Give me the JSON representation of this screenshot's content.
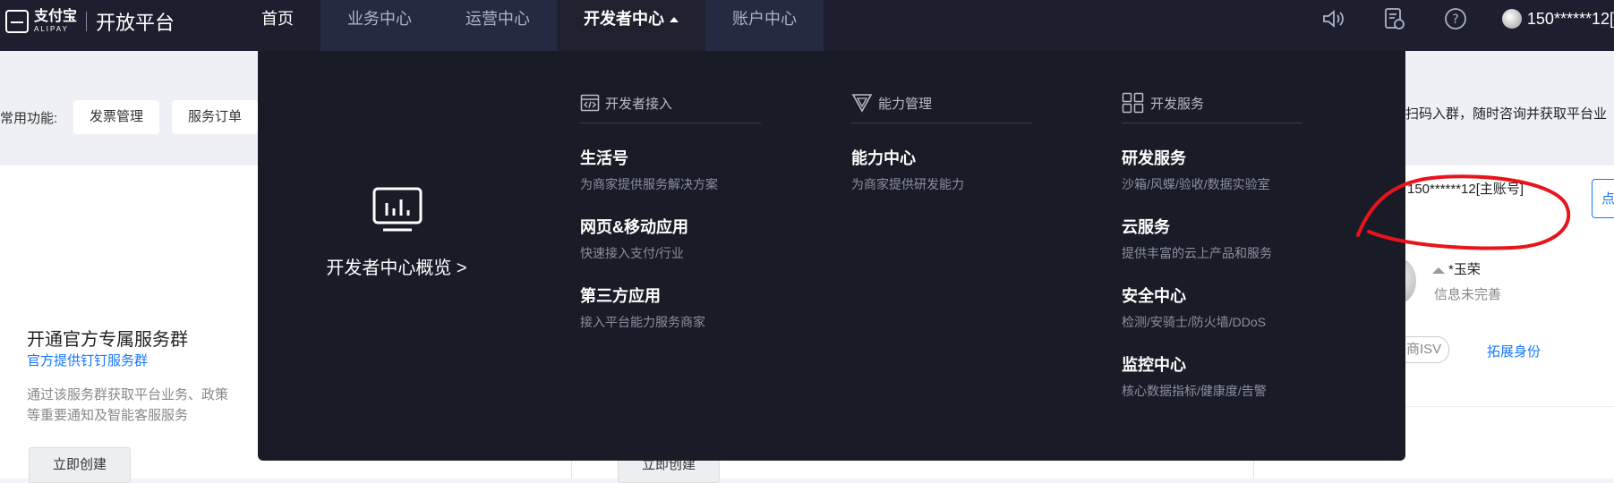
{
  "header": {
    "logo_cn": "支付宝",
    "logo_en": "ALIPAY",
    "platform": "开放平台",
    "nav": [
      {
        "label": "首页"
      },
      {
        "label": "业务中心"
      },
      {
        "label": "运营中心"
      },
      {
        "label": "开发者中心"
      },
      {
        "label": "账户中心"
      }
    ],
    "user": "150******12["
  },
  "quick": {
    "label": "常用功能:",
    "buttons": [
      "发票管理",
      "服务订单"
    ]
  },
  "service_group": {
    "title": "开通官方专属服务群",
    "subtitle": "官方提供钉钉服务群",
    "desc": "通过该服务群获取平台业务、政策等重要通知及智能客服服务",
    "create_left": "立即创建",
    "create_mid": "立即创建"
  },
  "right_panel": {
    "scan_note": "扫码入群，随时咨询并获取平台业",
    "account": "150******12[主账号]",
    "tab": "点",
    "name": "*玉荣",
    "info": "信息未完善",
    "isv": "商ISV",
    "expand": "拓展身份"
  },
  "dropdown": {
    "overview": "开发者中心概览 >",
    "columns": [
      {
        "heading": "开发者接入",
        "icon": "code-icon",
        "items": [
          {
            "title": "生活号",
            "desc": "为商家提供服务解决方案"
          },
          {
            "title": "网页&移动应用",
            "desc": "快速接入支付/行业"
          },
          {
            "title": "第三方应用",
            "desc": "接入平台能力服务商家"
          }
        ]
      },
      {
        "heading": "能力管理",
        "icon": "triangle-icon",
        "items": [
          {
            "title": "能力中心",
            "desc": "为商家提供研发能力"
          }
        ]
      },
      {
        "heading": "开发服务",
        "icon": "grid-icon",
        "items": [
          {
            "title": "研发服务",
            "desc": "沙箱/风蝶/验收/数据实验室"
          },
          {
            "title": "云服务",
            "desc": "提供丰富的云上产品和服务"
          },
          {
            "title": "安全中心",
            "desc": "检测/安骑士/防火墙/DDoS"
          },
          {
            "title": "监控中心",
            "desc": "核心数据指标/健康度/告警"
          }
        ]
      }
    ]
  },
  "colors": {
    "accent": "#1677ff",
    "dropdown_bg": "#191b27",
    "annotation": "#e8141b"
  }
}
